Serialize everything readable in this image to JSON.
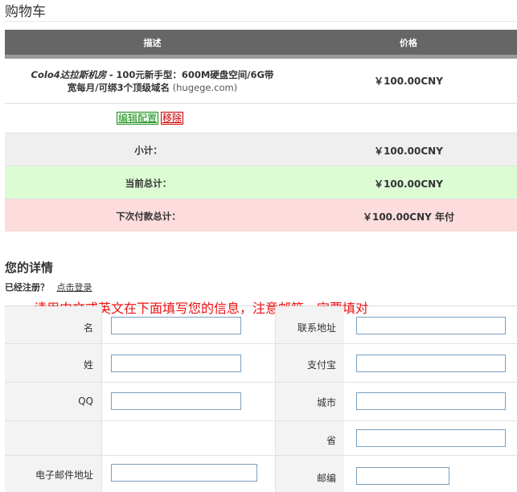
{
  "page": {
    "title": "购物车"
  },
  "cart": {
    "header": {
      "description": "描述",
      "price": "价格"
    },
    "product": {
      "name": "Colo4达拉斯机房",
      "dash": "-",
      "plan_line1": "100元新手型：600M硬盘空间/6G带",
      "plan_line2": "宽每月/可绑3个顶级域名",
      "domain": "(hugege.com)",
      "price": "￥100.00CNY"
    },
    "actions": {
      "edit_label": "编辑配置",
      "remove_label": "移除"
    },
    "subtotal": {
      "label": "小计：",
      "value": "￥100.00CNY"
    },
    "total_due": {
      "label": "当前总计：",
      "value": "￥100.00CNY"
    },
    "recurring": {
      "label": "下次付款总计：",
      "value": "￥100.00CNY 年付"
    },
    "colors": {
      "header_bg": "#666666",
      "total_bg": "#dcfcd4",
      "recurring_bg": "#fcdcdc",
      "subtotal_bg": "#efefef"
    }
  },
  "details": {
    "title": "您的详情",
    "registered_question": "已经注册？",
    "login_link": "点击登录",
    "notice": "请用中文或英文在下面填写您的信息，注意邮箱一定要填对",
    "notice_color": "#ee1111",
    "fields": {
      "first_name": {
        "label": "名",
        "value": ""
      },
      "last_name": {
        "label": "姓",
        "value": ""
      },
      "qq": {
        "label": "QQ",
        "value": ""
      },
      "email": {
        "label": "电子邮件地址",
        "value": ""
      },
      "address": {
        "label": "联系地址",
        "value": ""
      },
      "alipay": {
        "label": "支付宝",
        "value": ""
      },
      "city": {
        "label": "城市",
        "value": ""
      },
      "state": {
        "label": "省",
        "value": ""
      },
      "postcode": {
        "label": "邮编",
        "value": ""
      }
    }
  }
}
